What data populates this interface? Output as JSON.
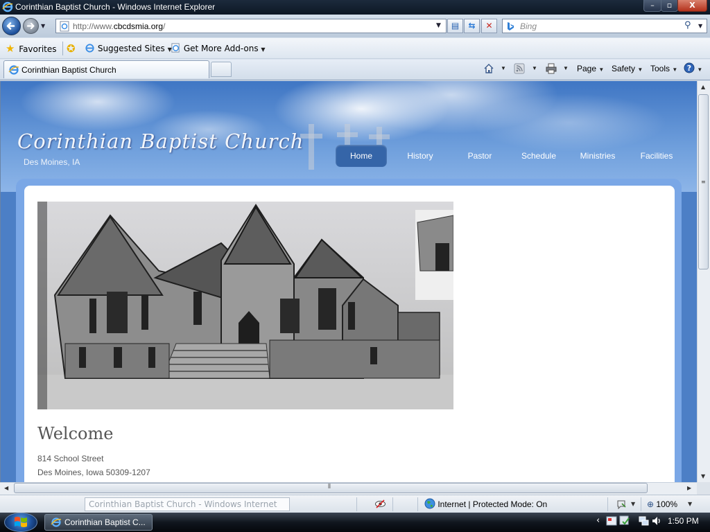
{
  "window": {
    "title": "Corinthian Baptist Church - Windows Internet Explorer",
    "minimize_glyph": "–",
    "maximize_glyph": "▫",
    "close_glyph": "X"
  },
  "address_bar": {
    "url_prefix": "http://www.",
    "url_host": "cbcdsmia.org",
    "url_suffix": "/"
  },
  "search": {
    "placeholder": "Bing"
  },
  "favorites_bar": {
    "favorites_label": "Favorites",
    "suggested_label": "Suggested Sites",
    "addons_label": "Get More Add-ons"
  },
  "tab": {
    "label": "Corinthian Baptist Church"
  },
  "command_bar": {
    "page_label": "Page",
    "safety_label": "Safety",
    "tools_label": "Tools"
  },
  "site": {
    "title": "Corinthian Baptist Church",
    "location": "Des Moines, IA",
    "nav": [
      "Home",
      "History",
      "Pastor",
      "Schedule",
      "Ministries",
      "Facilities"
    ],
    "welcome_heading": "Welcome",
    "address_line1": "814 School Street",
    "address_line2": "Des Moines, Iowa 50309-1207"
  },
  "status_bar": {
    "tooltip": "Corinthian Baptist Church - Windows Internet Explorer",
    "zone": "Internet | Protected Mode: On",
    "zoom": "100%"
  },
  "taskbar": {
    "task_label": "Corinthian Baptist C...",
    "clock": "1:50 PM"
  },
  "colors": {
    "nav_active_bg": "#3565a8",
    "sky_blue": "#4c7fc6",
    "frame_blue": "#7aa7e6"
  },
  "icons": [
    "ie-logo",
    "back-arrow",
    "forward-arrow",
    "compat-view",
    "refresh",
    "stop",
    "bing-logo",
    "search-magnifier",
    "favorites-star",
    "add-favorites-star",
    "home",
    "feeds",
    "print",
    "help"
  ]
}
